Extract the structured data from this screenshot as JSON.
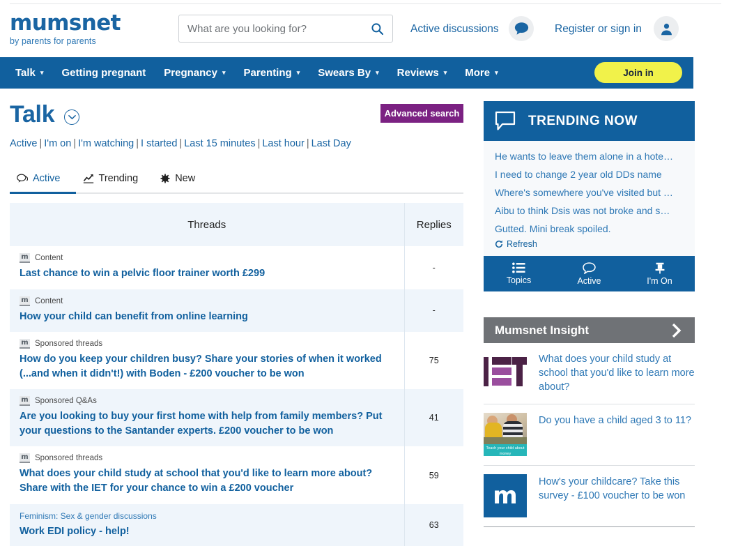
{
  "header": {
    "logo_word": "mumsnet",
    "logo_tagline": "by parents for parents",
    "search_placeholder": "What are you looking for?",
    "search_value": "",
    "active_discussions": "Active discussions",
    "register_sign_in": "Register or sign in",
    "search_icon": "search-icon",
    "chat_icon": "chat-bubble-icon",
    "user_icon": "user-avatar-icon"
  },
  "nav": {
    "items": [
      {
        "label": "Talk",
        "has_caret": true
      },
      {
        "label": "Getting pregnant",
        "has_caret": false
      },
      {
        "label": "Pregnancy",
        "has_caret": true
      },
      {
        "label": "Parenting",
        "has_caret": true
      },
      {
        "label": "Swears By",
        "has_caret": true
      },
      {
        "label": "Reviews",
        "has_caret": true
      },
      {
        "label": "More",
        "has_caret": true
      }
    ],
    "join_in": "Join in",
    "bar_color": "#11609e",
    "join_color": "#f1f24a"
  },
  "page": {
    "title": "Talk",
    "advanced_search": "Advanced search",
    "advanced_search_color": "#7b2182",
    "filters": [
      "Active",
      "I'm on",
      "I'm watching",
      "I started",
      "Last 15 minutes",
      "Last hour",
      "Last Day"
    ],
    "tabs": [
      {
        "label": "Active",
        "icon": "comments-icon",
        "active": true
      },
      {
        "label": "Trending",
        "icon": "chart-line-icon",
        "active": false
      },
      {
        "label": "New",
        "icon": "asterisk-icon",
        "active": false
      }
    ]
  },
  "table": {
    "columns": [
      "Threads",
      "Replies"
    ],
    "rows": [
      {
        "badge": "m",
        "category": "Content",
        "category_type": "content",
        "title": "Last chance to win a pelvic floor trainer worth £299",
        "replies": "-",
        "shaded": false
      },
      {
        "badge": "m",
        "category": "Content",
        "category_type": "content",
        "title": "How your child can benefit from online learning",
        "replies": "-",
        "shaded": true
      },
      {
        "badge": "m",
        "category": "Sponsored threads",
        "category_type": "sponsored",
        "title": "How do you keep your children busy? Share your stories of when it worked (...and when it didn't!) with Boden - £200 voucher to be won",
        "replies": "75",
        "shaded": false
      },
      {
        "badge": "m",
        "category": "Sponsored Q&As",
        "category_type": "sponsored",
        "title": "Are you looking to buy your first home with help from family members? Put your questions to the Santander experts. £200 voucher to be won",
        "replies": "41",
        "shaded": true
      },
      {
        "badge": "m",
        "category": "Sponsored threads",
        "category_type": "sponsored",
        "title": "What does your child study at school that you'd like to learn more about? Share with the IET for your chance to win a £200 voucher",
        "replies": "59",
        "shaded": false
      },
      {
        "badge": "",
        "category": "Feminism: Sex & gender discussions",
        "category_type": "topic",
        "title": "Work EDI policy - help!",
        "replies": "63",
        "shaded": true
      }
    ]
  },
  "trending": {
    "heading": "TRENDING NOW",
    "heading_icon": "speech-bubble-icon",
    "items": [
      "He wants to leave them alone in a hote…",
      "I need to change 2 year old DDs name",
      "Where's somewhere you've visited but …",
      "Aibu to think Dsis was not broke and s…",
      "Gutted. Mini break spoiled."
    ],
    "refresh": "Refresh",
    "refresh_icon": "refresh-icon",
    "footer": [
      {
        "label": "Topics",
        "icon": "list-icon"
      },
      {
        "label": "Active",
        "icon": "speech-bubble-icon"
      },
      {
        "label": "I'm On",
        "icon": "pin-icon"
      }
    ]
  },
  "insight": {
    "heading": "Mumsnet Insight",
    "heading_icon": "chevron-right-icon",
    "heading_color": "#6f7276",
    "items": [
      {
        "thumb": "iet-logo",
        "text": "What does your child study at school that you'd like to learn more about?"
      },
      {
        "thumb": "children-photo",
        "thumb_caption": "Teach your child about money",
        "text": "Do you have a child aged 3 to 11?"
      },
      {
        "thumb": "mumsnet-m-logo",
        "text": "How's your childcare? Take this survey - £100 voucher to be won"
      }
    ]
  }
}
